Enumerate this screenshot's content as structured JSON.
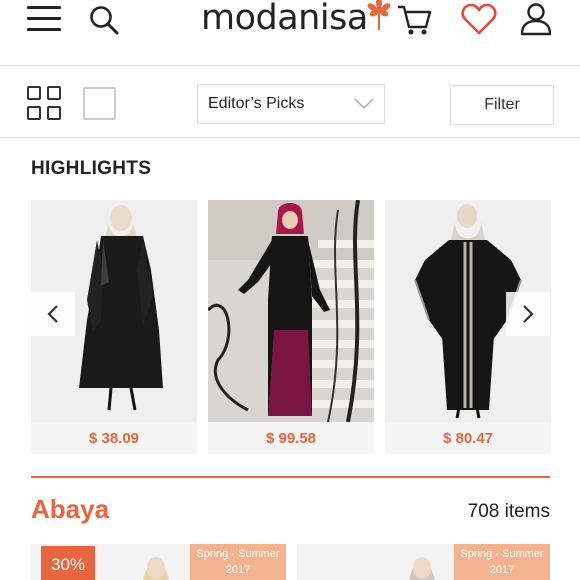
{
  "header": {
    "logo_text": "modanisa",
    "icons": [
      "menu-icon",
      "search-icon",
      "cart-icon",
      "heart-icon",
      "user-icon"
    ]
  },
  "toolbar": {
    "sort_label": "Editor’s Picks",
    "filter_label": "Filter"
  },
  "highlights": {
    "title": "HIGHLIGHTS",
    "items": [
      {
        "price": "$ 38.09"
      },
      {
        "price": "$ 99.58"
      },
      {
        "price": "$ 80.47"
      }
    ]
  },
  "category": {
    "title": "Abaya",
    "count": "708 items",
    "tiles": [
      {
        "badge": "30%",
        "season_line1": "Spring - Summer",
        "season_line2": "2017"
      },
      {
        "season_line1": "Spring - Summer",
        "season_line2": "2017"
      }
    ]
  },
  "colors": {
    "accent": "#e8663d",
    "season_badge": "#f4b28f",
    "heart": "#e8463d"
  }
}
